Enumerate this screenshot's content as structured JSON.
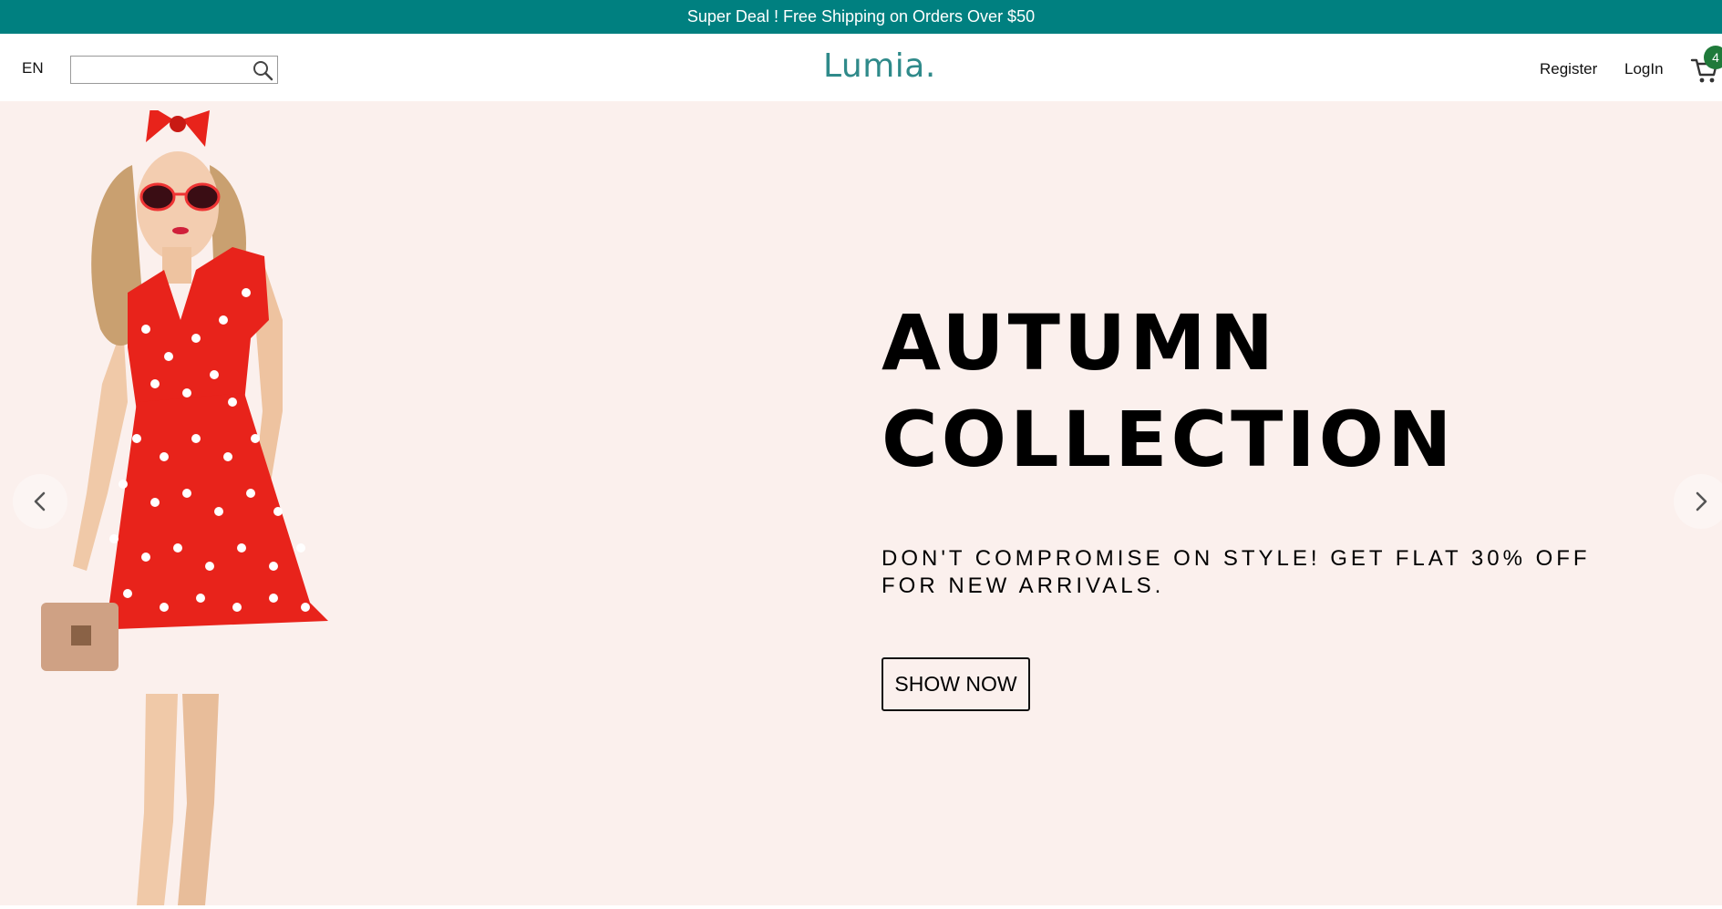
{
  "announcement": {
    "text": "Super Deal ! Free Shipping on Orders Over $50"
  },
  "header": {
    "language": "EN",
    "search": {
      "value": "",
      "placeholder": ""
    },
    "logo": "Lumia.",
    "nav": {
      "register": "Register",
      "login": "LogIn"
    },
    "cart_count": "4"
  },
  "hero": {
    "title_line1": "AUTUMN",
    "title_line2": "COLLECTION",
    "description": "DON'T COMPROMISE ON STYLE! GET FLAT 30% OFF FOR NEW ARRIVALS.",
    "button_label": "SHOW NOW"
  },
  "colors": {
    "announcement_bg": "#008080",
    "logo": "#2f8a8a",
    "hero_bg": "#fbf0ed",
    "cart_badge": "#1f7a3a",
    "dress": "#e8231b"
  },
  "icons": {
    "search": "search-icon",
    "cart": "cart-icon",
    "prev": "chevron-left-icon",
    "next": "chevron-right-icon"
  }
}
